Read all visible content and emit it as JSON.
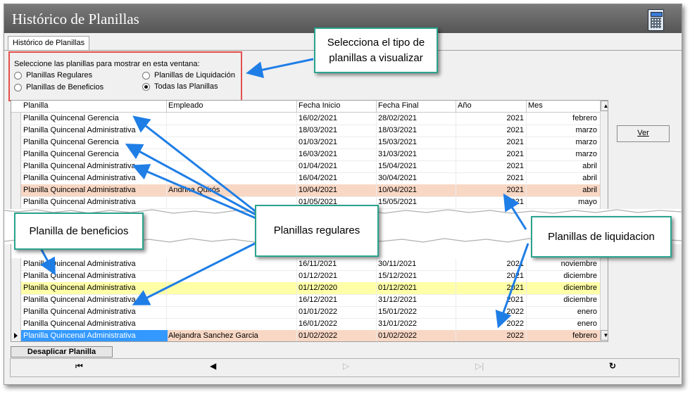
{
  "window": {
    "title": "Histórico de Planillas"
  },
  "tab": {
    "label": "Histórico de Planillas"
  },
  "selector": {
    "prompt": "Seleccione las planillas para mostrar en esta ventana:",
    "options": [
      {
        "label": "Planillas Regulares",
        "checked": false
      },
      {
        "label": "Planillas de Liquidación",
        "checked": false
      },
      {
        "label": "Planillas de Beneficios",
        "checked": false
      },
      {
        "label": "Todas las Planillas",
        "checked": true
      }
    ]
  },
  "grid": {
    "columns": [
      "Planilla",
      "Empleado",
      "Fecha Inicio",
      "Fecha Final",
      "Año",
      "Mes"
    ],
    "top_rows": [
      {
        "planilla": "Planilla Quincenal Gerencia",
        "empleado": "",
        "inicio": "16/02/2021",
        "final": "28/02/2021",
        "anio": "2021",
        "mes": "febrero",
        "color": ""
      },
      {
        "planilla": "Planilla Quincenal Administrativa",
        "empleado": "",
        "inicio": "18/03/2021",
        "final": "18/03/2021",
        "anio": "2021",
        "mes": "marzo",
        "color": ""
      },
      {
        "planilla": "Planilla Quincenal Gerencia",
        "empleado": "",
        "inicio": "01/03/2021",
        "final": "15/03/2021",
        "anio": "2021",
        "mes": "marzo",
        "color": ""
      },
      {
        "planilla": "Planilla Quincenal Gerencia",
        "empleado": "",
        "inicio": "16/03/2021",
        "final": "31/03/2021",
        "anio": "2021",
        "mes": "marzo",
        "color": ""
      },
      {
        "planilla": "Planilla Quincenal Administrativa",
        "empleado": "",
        "inicio": "01/04/2021",
        "final": "15/04/2021",
        "anio": "2021",
        "mes": "abril",
        "color": ""
      },
      {
        "planilla": "Planilla Quincenal Administrativa",
        "empleado": "",
        "inicio": "16/04/2021",
        "final": "30/04/2021",
        "anio": "2021",
        "mes": "abril",
        "color": ""
      },
      {
        "planilla": "Planilla Quincenal Administrativa",
        "empleado": "Andrina Quirós",
        "inicio": "10/04/2021",
        "final": "10/04/2021",
        "anio": "2021",
        "mes": "abril",
        "color": "orange"
      },
      {
        "planilla": "Planilla Quincenal Administrativa",
        "empleado": "",
        "inicio": "01/05/2021",
        "final": "15/05/2021",
        "anio": "2021",
        "mes": "mayo",
        "color": ""
      }
    ],
    "bottom_rows": [
      {
        "planilla": "Planilla Quincenal Administrativa",
        "empleado": "",
        "inicio": "16/11/2021",
        "final": "30/11/2021",
        "anio": "2021",
        "mes": "noviembre",
        "color": ""
      },
      {
        "planilla": "Planilla Quincenal Administrativa",
        "empleado": "",
        "inicio": "01/12/2021",
        "final": "15/12/2021",
        "anio": "2021",
        "mes": "diciembre",
        "color": ""
      },
      {
        "planilla": "Planilla Quincenal Administrativa",
        "empleado": "",
        "inicio": "01/12/2020",
        "final": "01/12/2021",
        "anio": "2021",
        "mes": "diciembre",
        "color": "yellow"
      },
      {
        "planilla": "Planilla Quincenal Administrativa",
        "empleado": "",
        "inicio": "16/12/2021",
        "final": "31/12/2021",
        "anio": "2021",
        "mes": "diciembre",
        "color": ""
      },
      {
        "planilla": "Planilla Quincenal Administrativa",
        "empleado": "",
        "inicio": "01/01/2022",
        "final": "15/01/2022",
        "anio": "2022",
        "mes": "enero",
        "color": ""
      },
      {
        "planilla": "Planilla Quincenal Administrativa",
        "empleado": "",
        "inicio": "16/01/2022",
        "final": "31/01/2022",
        "anio": "2022",
        "mes": "enero",
        "color": ""
      },
      {
        "planilla": "Planilla Quincenal Administrativa",
        "empleado": "Alejandra Sanchez Garcia",
        "inicio": "01/02/2022",
        "final": "01/02/2022",
        "anio": "2022",
        "mes": "febrero",
        "color": "orange",
        "selected": true
      }
    ]
  },
  "buttons": {
    "ver": "Ver",
    "desaplicar": "Desaplicar Planilla"
  },
  "navigator": {
    "first": "⏮",
    "prev": "◀",
    "next": "▷",
    "last": "▷|",
    "refresh": "↻"
  },
  "callouts": {
    "tipo": "Selecciona el tipo de planillas a visualizar",
    "beneficios": "Planilla de beneficios",
    "regulares": "Planillas regulares",
    "liquidacion": "Planillas de liquidacion"
  },
  "colors": {
    "orange_row": "#f8d7c4",
    "yellow_row": "#ffffa8",
    "selected": "#3399ff",
    "callout_border": "#2aa38e",
    "arrow": "#1f7ee6",
    "highlight_border": "#e3504a"
  }
}
